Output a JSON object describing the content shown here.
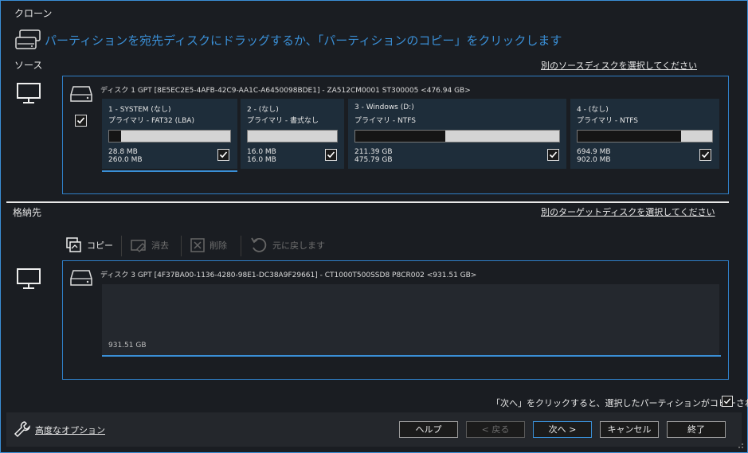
{
  "window": {
    "title": "クローン"
  },
  "instruction": "パーティションを宛先ディスクにドラッグするか、「パーティションのコピー」をクリックします",
  "source": {
    "label": "ソース",
    "select_link": "別のソースディスクを選択してください",
    "disk_header": "ディスク 1 GPT [8E5EC2E5-4AFB-42C9-AA1C-A6450098BDE1] - ZA512CM0001 ST300005  <476.94 GB>",
    "partitions": [
      {
        "name": "1 - SYSTEM (なし)",
        "type": "プライマリ - FAT32 (LBA)",
        "used": "28.8 MB",
        "total": "260.0 MB",
        "fill": 0.1,
        "checked": true
      },
      {
        "name": "2 - (なし)",
        "type": "プライマリ - 書式なし",
        "used": "16.0 MB",
        "total": "16.0 MB",
        "fill": 0.0,
        "checked": true
      },
      {
        "name": "3 - Windows (D:)",
        "type": "プライマリ - NTFS",
        "used": "211.39 GB",
        "total": "475.79 GB",
        "fill": 0.44,
        "checked": true
      },
      {
        "name": "4 - (なし)",
        "type": "プライマリ - NTFS",
        "used": "694.9 MB",
        "total": "902.0 MB",
        "fill": 0.77,
        "checked": true
      }
    ]
  },
  "destination": {
    "label": "格納先",
    "select_link": "別のターゲットディスクを選択してください",
    "disk_header": "ディスク 3 GPT [4F37BA00-1136-4280-98E1-DC38A9F29661] - CT1000T500SSD8 P8CR002  <931.51 GB>",
    "free_size": "931.51 GB"
  },
  "toolbar": {
    "copy": "コピー",
    "erase": "消去",
    "delete": "削除",
    "undo": "元に戻します"
  },
  "notice": "「次へ」をクリックすると、選択したパーティションがコピーされます",
  "footer": {
    "advanced": "高度なオプション",
    "help": "ヘルプ",
    "back": "< 戻る",
    "next": "次へ >",
    "cancel": "キャンセル",
    "finish": "終了"
  },
  "colors": {
    "accent": "#3a8fd6",
    "partition_bg": "#1e2d3a",
    "panel_bg": "#1a1d22"
  }
}
